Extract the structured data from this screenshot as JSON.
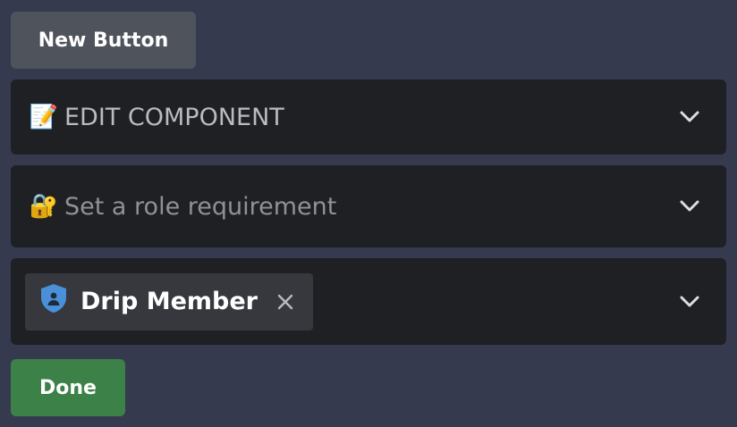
{
  "new_button": {
    "label": "New Button"
  },
  "edit_component": {
    "emoji": "📝",
    "label": "EDIT COMPONENT",
    "icon": "chevron-down-icon"
  },
  "role_requirement": {
    "emoji": "🔐",
    "placeholder": "Set a role requirement",
    "icon": "chevron-down-icon"
  },
  "role_select": {
    "selected": [
      {
        "label": "Drip Member",
        "icon": "role-shield-icon",
        "icon_color": "#4a90d9",
        "remove_icon": "close-icon"
      }
    ],
    "icon": "chevron-down-icon"
  },
  "done_button": {
    "label": "Done",
    "color": "#3c8248"
  },
  "colors": {
    "background": "#363a4f",
    "select_background": "#1f2024",
    "secondary_button": "#4f535c",
    "chip_background": "#36383e"
  }
}
